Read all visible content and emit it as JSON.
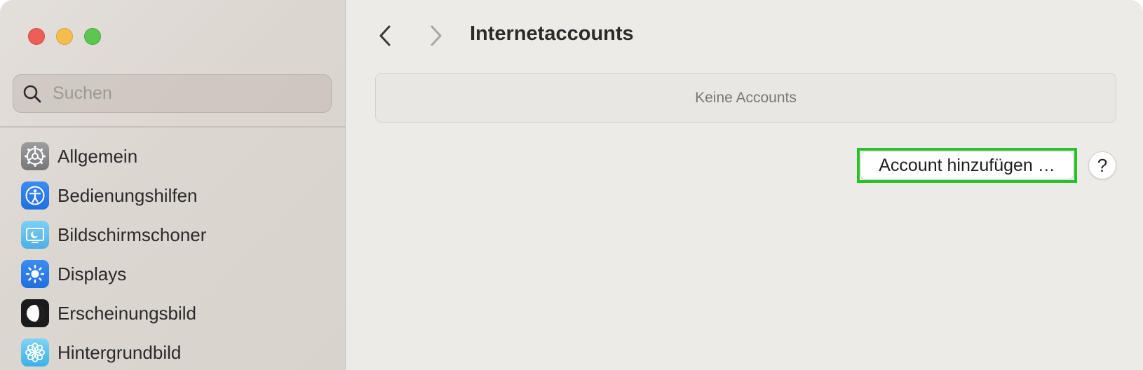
{
  "window": {
    "traffic_lights": [
      "close",
      "minimize",
      "zoom"
    ]
  },
  "sidebar": {
    "search": {
      "placeholder": "Suchen",
      "value": ""
    },
    "items": [
      {
        "label": "Allgemein",
        "icon": "gear-icon"
      },
      {
        "label": "Bedienungshilfen",
        "icon": "accessibility-icon"
      },
      {
        "label": "Bildschirmschoner",
        "icon": "screensaver-icon"
      },
      {
        "label": "Displays",
        "icon": "brightness-icon"
      },
      {
        "label": "Erscheinungsbild",
        "icon": "appearance-icon"
      },
      {
        "label": "Hintergrundbild",
        "icon": "flower-icon"
      }
    ]
  },
  "main": {
    "title": "Internetaccounts",
    "accounts_empty_label": "Keine Accounts",
    "add_account_label": "Account hinzufügen …",
    "help_label": "?"
  },
  "colors": {
    "highlight": "#27c22a",
    "close": "#ec5f58",
    "minimize": "#f5bd4f",
    "zoom": "#5ec552"
  }
}
